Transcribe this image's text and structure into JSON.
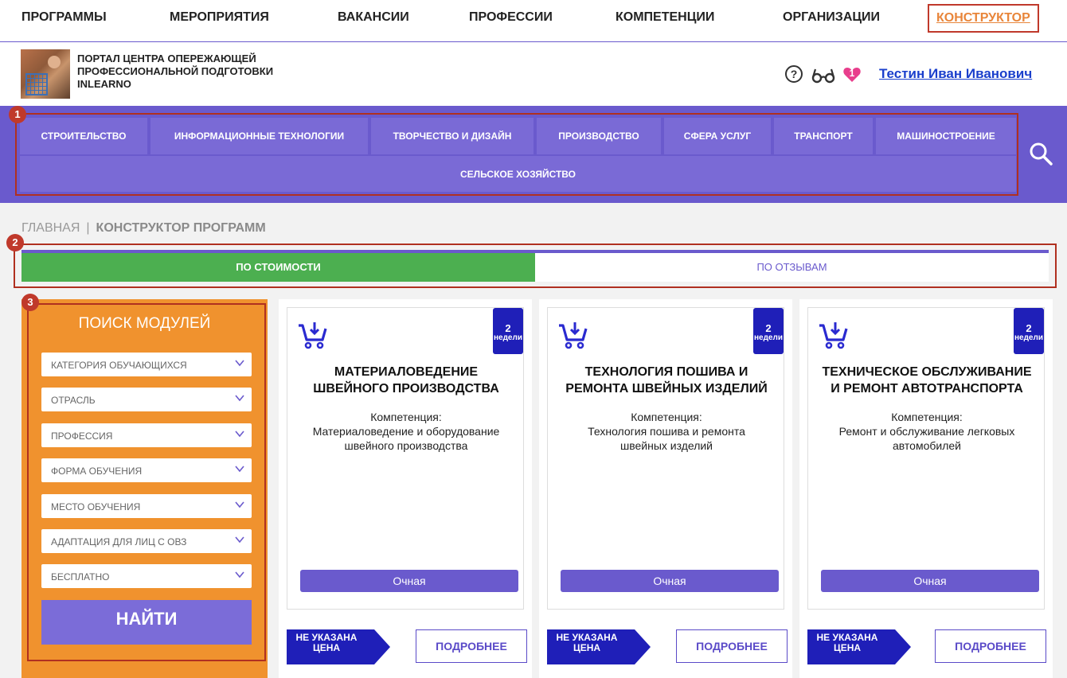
{
  "topnav": {
    "items": [
      "ПРОГРАММЫ",
      "МЕРОПРИЯТИЯ",
      "ВАКАНСИИ",
      "ПРОФЕССИИ",
      "КОМПЕТЕНЦИИ",
      "ОРГАНИЗАЦИИ"
    ],
    "active": "КОНСТРУКТОР"
  },
  "header": {
    "logo_lines": [
      "ПОРТАЛ ЦЕНТРА ОПЕРЕЖАЮЩЕЙ",
      "ПРОФЕССИОНАЛЬНОЙ ПОДГОТОВКИ",
      "INLEARNO"
    ],
    "help_glyph": "?",
    "favorites_count": "1",
    "user_name": "Тестин Иван Иванович"
  },
  "categories": {
    "row1": [
      "СТРОИТЕЛЬСТВО",
      "ИНФОРМАЦИОННЫЕ ТЕХНОЛОГИИ",
      "ТВОРЧЕСТВО И ДИЗАЙН",
      "ПРОИЗВОДСТВО",
      "СФЕРА УСЛУГ",
      "ТРАНСПОРТ",
      "МАШИНОСТРОЕНИЕ"
    ],
    "row2": [
      "СЕЛЬСКОЕ ХОЗЯЙСТВО"
    ]
  },
  "badges": [
    "1",
    "2",
    "3"
  ],
  "breadcrumb": {
    "home": "ГЛАВНАЯ",
    "separator": "|",
    "current": "КОНСТРУКТОР ПРОГРАММ"
  },
  "sort_tabs": {
    "cost": "ПО СТОИМОСТИ",
    "reviews": "ПО ОТЗЫВАМ"
  },
  "search_panel": {
    "title": "ПОИСК МОДУЛЕЙ",
    "filters": [
      "КАТЕГОРИЯ ОБУЧАЮЩИХСЯ",
      "ОТРАСЛЬ",
      "ПРОФЕССИЯ",
      "ФОРМА ОБУЧЕНИЯ",
      "МЕСТО ОБУЧЕНИЯ",
      "АДАПТАЦИЯ ДЛЯ ЛИЦ С ОВЗ",
      "БЕСПЛАТНО"
    ],
    "find_label": "НАЙТИ"
  },
  "cards": [
    {
      "weeks_num": "2",
      "weeks_label": "недели",
      "title_lines": [
        "МАТЕРИАЛОВЕДЕНИЕ",
        "ШВЕЙНОГО ПРОИЗВОДСТВА"
      ],
      "comp_label": "Компетенция:",
      "comp_lines": [
        "Материаловедение и оборудование",
        "швейного производства"
      ],
      "form": "Очная",
      "price_lines": [
        "НЕ УКАЗАНА",
        "ЦЕНА"
      ],
      "more_label": "ПОДРОБНЕЕ"
    },
    {
      "weeks_num": "2",
      "weeks_label": "недели",
      "title_lines": [
        "ТЕХНОЛОГИЯ ПОШИВА И",
        "РЕМОНТА ШВЕЙНЫХ ИЗДЕЛИЙ"
      ],
      "comp_label": "Компетенция:",
      "comp_lines": [
        "Технология пошива и ремонта",
        "швейных изделий"
      ],
      "form": "Очная",
      "price_lines": [
        "НЕ УКАЗАНА",
        "ЦЕНА"
      ],
      "more_label": "ПОДРОБНЕЕ"
    },
    {
      "weeks_num": "2",
      "weeks_label": "недели",
      "title_lines": [
        "ТЕХНИЧЕСКОЕ ОБСЛУЖИВАНИЕ",
        "И РЕМОНТ АВТОТРАНСПОРТА"
      ],
      "comp_label": "Компетенция:",
      "comp_lines": [
        "Ремонт и обслуживание легковых",
        "автомобилей"
      ],
      "form": "Очная",
      "price_lines": [
        "НЕ УКАЗАНА",
        "ЦЕНА"
      ],
      "more_label": "ПОДРОБНЕЕ"
    }
  ],
  "colors": {
    "accent_purple": "#6a5acd",
    "nav_blue": "#1f1fb8",
    "active_green": "#4caf50",
    "panel_orange": "#f0922e",
    "highlight_red": "#b03020",
    "user_link": "#1a3fcc"
  },
  "icons": [
    "help-icon",
    "glasses-icon",
    "heart-icon",
    "search-icon",
    "cart-icon",
    "chevron-down-icon"
  ]
}
